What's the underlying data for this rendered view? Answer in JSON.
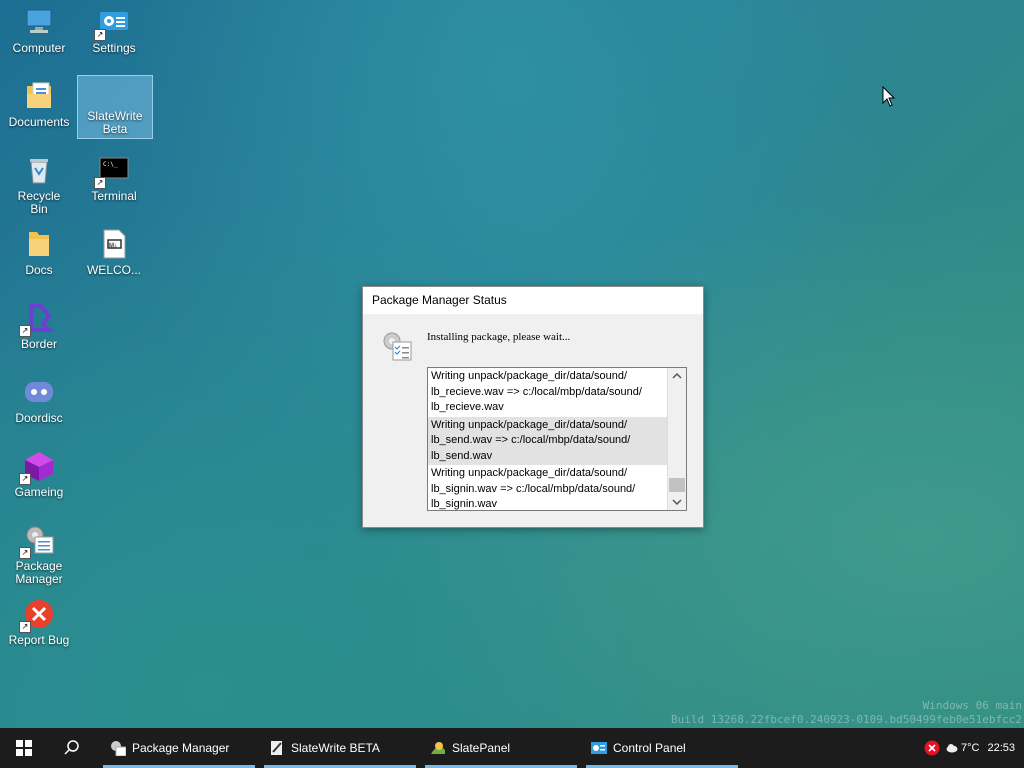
{
  "desktop": {
    "icons": [
      {
        "label": "Computer",
        "icon": "computer-icon"
      },
      {
        "label": "Settings",
        "icon": "settings-icon"
      },
      {
        "label": "Documents",
        "icon": "documents-folder-icon"
      },
      {
        "label": "SlateWrite Beta",
        "icon": "slatewrite-icon"
      },
      {
        "label": "Recycle Bin",
        "icon": "recycle-bin-icon"
      },
      {
        "label": "Terminal",
        "icon": "terminal-icon"
      },
      {
        "label": "Docs",
        "icon": "folder-icon"
      },
      {
        "label": "WELCO...",
        "icon": "markdown-file-icon"
      },
      {
        "label": "Border",
        "icon": "border-icon"
      },
      {
        "label": "Doordisc",
        "icon": "doordisc-icon"
      },
      {
        "label": "Gameing",
        "icon": "gameing-icon"
      },
      {
        "label": "Package Manager",
        "icon": "package-manager-icon"
      },
      {
        "label": "Report Bug",
        "icon": "report-bug-icon"
      }
    ]
  },
  "dialog": {
    "title": "Package Manager Status",
    "message": "Installing package, please wait...",
    "log": [
      [
        "Writing unpack/package_dir/data/sound/",
        "lb_recieve.wav => c:/local/mbp/data/sound/",
        "lb_recieve.wav"
      ],
      [
        "Writing unpack/package_dir/data/sound/",
        "lb_send.wav => c:/local/mbp/data/sound/",
        "lb_send.wav"
      ],
      [
        "Writing unpack/package_dir/data/sound/",
        "lb_signin.wav => c:/local/mbp/data/sound/",
        "lb_signin.wav"
      ]
    ]
  },
  "watermark": {
    "line1": "Windows 06 main",
    "line2": "Build 13268.22fbcef0.240923-0109.bd50499feb0e51ebfcc2"
  },
  "taskbar": {
    "items": [
      {
        "label": "Package Manager",
        "icon": "package-manager-icon"
      },
      {
        "label": "SlateWrite BETA",
        "icon": "slatewrite-icon"
      },
      {
        "label": "SlatePanel",
        "icon": "slatepanel-icon"
      },
      {
        "label": "Control Panel",
        "icon": "control-panel-icon"
      }
    ],
    "temperature": "7°C",
    "time": "22:53"
  },
  "colors": {
    "accent": "#76b9ed",
    "taskbar_bg": "#1c1c1c",
    "dialog_bg": "#f0f0f0",
    "error_red": "#e81123"
  }
}
